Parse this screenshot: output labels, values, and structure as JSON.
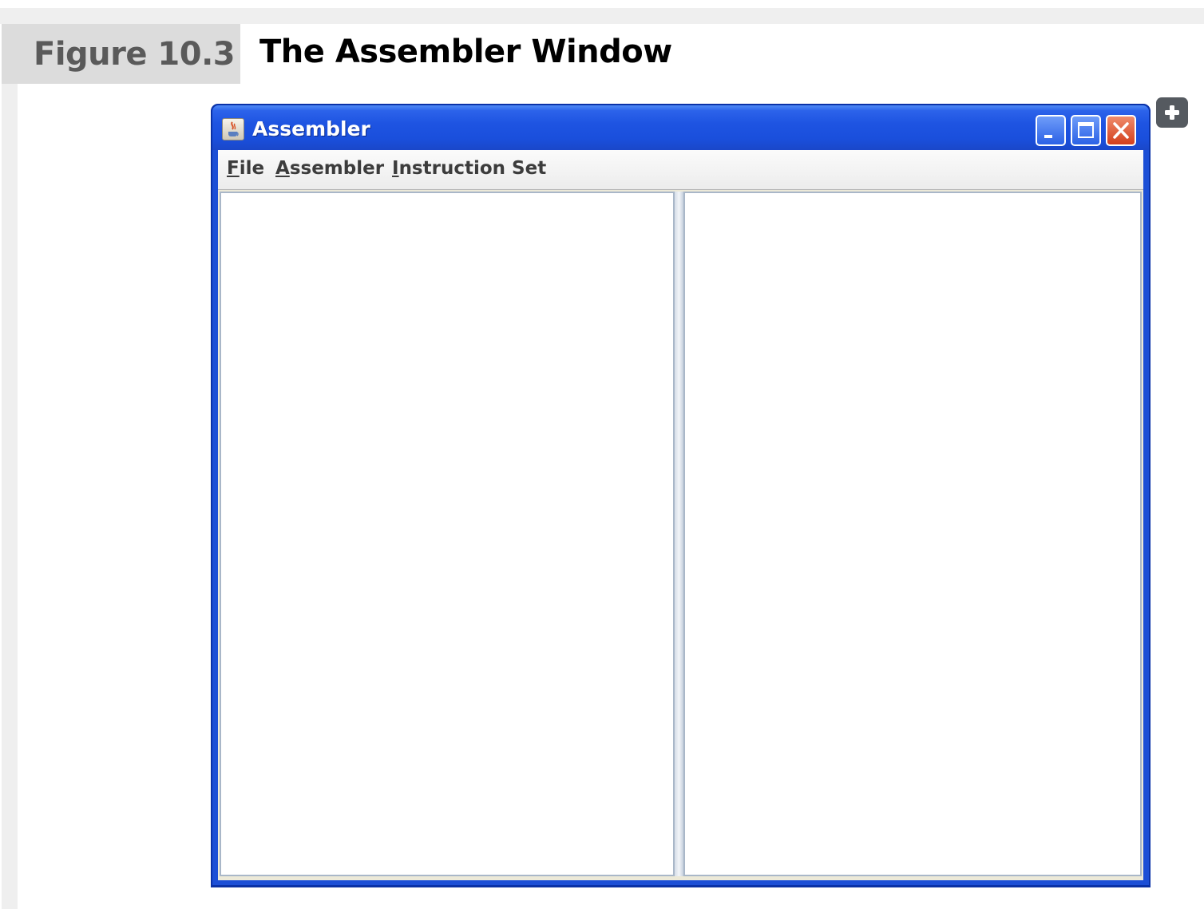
{
  "figure": {
    "label": "Figure 10.3",
    "title": "The Assembler Window"
  },
  "icons": {
    "expand": "plus-icon",
    "app": "java-cup-icon",
    "minimize": "minimize-icon",
    "maximize": "maximize-icon",
    "close": "close-icon"
  },
  "window": {
    "title": "Assembler",
    "menu": [
      "File",
      "Assembler",
      "Instruction Set"
    ]
  },
  "colors": {
    "titlebar": "#1e54e2",
    "close_button": "#d33f1c",
    "figure_label_bg": "#dcdcdc"
  }
}
